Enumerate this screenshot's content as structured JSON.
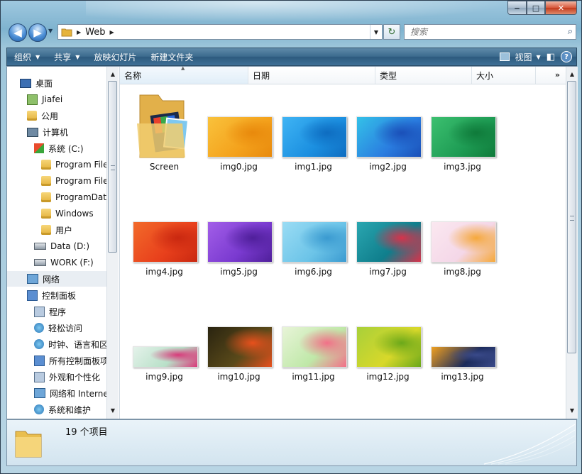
{
  "window": {
    "min_glyph": "‒",
    "max_glyph": "□",
    "close_glyph": "✕"
  },
  "nav": {
    "back_glyph": "◀",
    "forward_glyph": "▶",
    "address_segments": [
      "Web"
    ],
    "search_placeholder": "搜索"
  },
  "toolbar": {
    "items": [
      {
        "label": "组织",
        "dropdown": true
      },
      {
        "label": "共享",
        "dropdown": true
      },
      {
        "label": "放映幻灯片",
        "dropdown": false
      },
      {
        "label": "新建文件夹",
        "dropdown": false
      }
    ],
    "view_label": "视图",
    "help_glyph": "?"
  },
  "sidebar": {
    "items": [
      {
        "label": "桌面",
        "icon": "desktop-icon"
      },
      {
        "label": "Jiafei",
        "icon": "user-folder-icon"
      },
      {
        "label": "公用",
        "icon": "folder-icon"
      },
      {
        "label": "计算机",
        "icon": "computer-icon"
      },
      {
        "label": "系统 (C:)",
        "icon": "windows-drive-icon"
      },
      {
        "label": "Program Files",
        "icon": "folder-icon"
      },
      {
        "label": "Program Files",
        "icon": "folder-icon"
      },
      {
        "label": "ProgramData",
        "icon": "folder-icon"
      },
      {
        "label": "Windows",
        "icon": "folder-icon"
      },
      {
        "label": "用户",
        "icon": "folder-icon"
      },
      {
        "label": "Data (D:)",
        "icon": "drive-icon"
      },
      {
        "label": "WORK (F:)",
        "icon": "drive-icon"
      },
      {
        "label": "网络",
        "icon": "network-icon",
        "selected": true
      },
      {
        "label": "控制面板",
        "icon": "control-panel-icon"
      },
      {
        "label": "程序",
        "icon": "programs-icon"
      },
      {
        "label": "轻松访问",
        "icon": "ease-of-access-icon"
      },
      {
        "label": "时钟、语言和区域",
        "icon": "clock-language-icon"
      },
      {
        "label": "所有控制面板项",
        "icon": "all-control-panel-icon"
      },
      {
        "label": "外观和个性化",
        "icon": "appearance-icon"
      },
      {
        "label": "网络和 Internet",
        "icon": "network-internet-icon"
      },
      {
        "label": "系统和维护",
        "icon": "system-maintenance-icon"
      }
    ]
  },
  "columns": [
    "名称",
    "日期",
    "类型",
    "大小"
  ],
  "columns_more": "»",
  "files": [
    {
      "name": "Screen",
      "kind": "folder"
    },
    {
      "name": "img0.jpg",
      "kind": "image",
      "palette": [
        "#f4a21c",
        "#f9c23c",
        "#e8890c"
      ]
    },
    {
      "name": "img1.jpg",
      "kind": "image",
      "palette": [
        "#1b8fe0",
        "#3fb4f4",
        "#0e6cc0"
      ]
    },
    {
      "name": "img2.jpg",
      "kind": "image",
      "palette": [
        "#2a7de0",
        "#34c1e8",
        "#1a4fb8"
      ]
    },
    {
      "name": "img3.jpg",
      "kind": "image",
      "palette": [
        "#1e9c54",
        "#3cc070",
        "#0f7a3a"
      ]
    },
    {
      "name": "img4.jpg",
      "kind": "image",
      "palette": [
        "#e8401c",
        "#f26a2a",
        "#c92810"
      ]
    },
    {
      "name": "img5.jpg",
      "kind": "image",
      "palette": [
        "#7a3ad0",
        "#a25ee8",
        "#4f1f9a"
      ]
    },
    {
      "name": "img6.jpg",
      "kind": "image",
      "palette": [
        "#6cc4e8",
        "#9adcf4",
        "#3a9ad0"
      ]
    },
    {
      "name": "img7.jpg",
      "kind": "image",
      "palette": [
        "#0f7e8c",
        "#2aa6b0",
        "#d8324a"
      ]
    },
    {
      "name": "img8.jpg",
      "kind": "image",
      "palette": [
        "#f4d7e8",
        "#fbe8f0",
        "#f5a83a"
      ]
    },
    {
      "name": "img9.jpg",
      "kind": "image",
      "palette": [
        "#b8e0c8",
        "#e4f2ea",
        "#d83a7a"
      ]
    },
    {
      "name": "img10.jpg",
      "kind": "image",
      "palette": [
        "#5a4a1a",
        "#2a2410",
        "#e8501c"
      ]
    },
    {
      "name": "img11.jpg",
      "kind": "image",
      "palette": [
        "#bfe8a8",
        "#e8f4d8",
        "#f27088"
      ]
    },
    {
      "name": "img12.jpg",
      "kind": "image",
      "palette": [
        "#d8d82a",
        "#a8d03a",
        "#6aa81a"
      ]
    },
    {
      "name": "img13.jpg",
      "kind": "image",
      "palette": [
        "#1a2a5a",
        "#f0a020",
        "#3a4a8a"
      ]
    }
  ],
  "status": {
    "count": "19 个项目"
  }
}
